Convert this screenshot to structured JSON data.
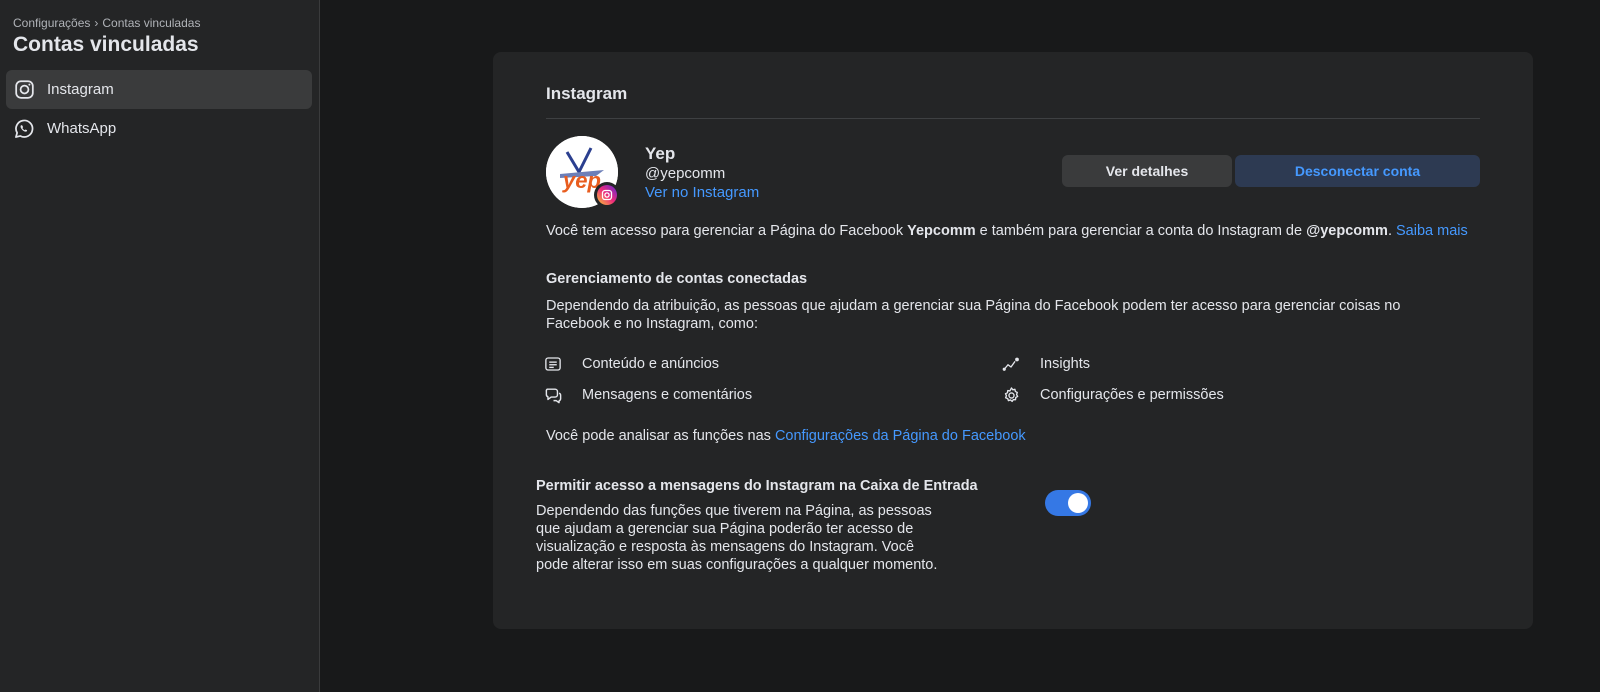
{
  "breadcrumb": {
    "parent": "Configurações",
    "separator": "›",
    "current": "Contas vinculadas"
  },
  "sidebar": {
    "title": "Contas vinculadas",
    "items": [
      {
        "label": "Instagram",
        "icon": "instagram-icon",
        "active": true
      },
      {
        "label": "WhatsApp",
        "icon": "whatsapp-icon",
        "active": false
      }
    ]
  },
  "card": {
    "title": "Instagram",
    "account": {
      "name": "Yep",
      "handle": "@yepcomm",
      "link_label": "Ver no Instagram",
      "avatar_text": "yep"
    },
    "buttons": {
      "details": "Ver detalhes",
      "disconnect": "Desconectar conta"
    },
    "access": {
      "part1": "Você tem acesso para gerenciar a Página do Facebook ",
      "page_name": "Yepcomm",
      "part2": " e também para gerenciar a conta do Instagram de ",
      "account": "@yepcomm",
      "part3": ". ",
      "link": "Saiba mais"
    },
    "management": {
      "title": "Gerenciamento de contas conectadas",
      "description": "Dependendo da atribuição, as pessoas que ajudam a gerenciar sua Página do Facebook podem ter acesso para gerenciar coisas no Facebook e no Instagram, como:",
      "permissions": [
        {
          "label": "Conteúdo e anúncios",
          "icon": "content-icon"
        },
        {
          "label": "Insights",
          "icon": "insights-icon"
        },
        {
          "label": "Mensagens e comentários",
          "icon": "messages-icon"
        },
        {
          "label": "Configurações e permissões",
          "icon": "settings-icon"
        }
      ]
    },
    "functions": {
      "text": "Você pode analisar as funções nas ",
      "link": "Configurações da Página do Facebook"
    },
    "inbox_toggle": {
      "title": "Permitir acesso a mensagens do Instagram na Caixa de Entrada",
      "description": "Dependendo das funções que tiverem na Página, as pessoas que ajudam a gerenciar sua Página poderão ter acesso de visualização e resposta às mensagens do Instagram. Você pode alterar isso em suas configurações a qualquer momento.",
      "enabled": true
    }
  },
  "colors": {
    "background": "#18191a",
    "surface": "#242526",
    "link": "#4599ff",
    "toggle_on": "#3578e5",
    "logo_blue": "#2b3f8f",
    "logo_orange": "#e85d1f"
  }
}
